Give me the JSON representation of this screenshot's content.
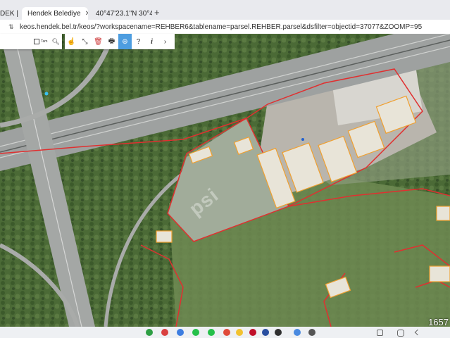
{
  "tabs": [
    {
      "label": "DEK |",
      "close": "✕"
    },
    {
      "label": "Hendek Belediye",
      "close": "✕"
    },
    {
      "label": "40°47'23.1\"N 30°4",
      "close": "✕"
    }
  ],
  "new_tab": "+",
  "address": {
    "url": "keos.hendek.bel.tr/keos/?workspacename=REHBER6&tablename=parsel.REHBER.parsel&dsfilter=objectid=37077&ZOOMP=95"
  },
  "search": {
    "checkbox_label": "Tam"
  },
  "watermark": "psi",
  "corner_number": "1657",
  "colors": {
    "accent": "#4d9de0",
    "parcel": "#e03030",
    "building": "#f0a030"
  },
  "icons": {
    "toolbar": [
      "hand-icon",
      "extent-icon",
      "trash-icon",
      "print-icon",
      "crosshair-icon",
      "help-icon",
      "info-icon",
      "next-icon"
    ]
  }
}
